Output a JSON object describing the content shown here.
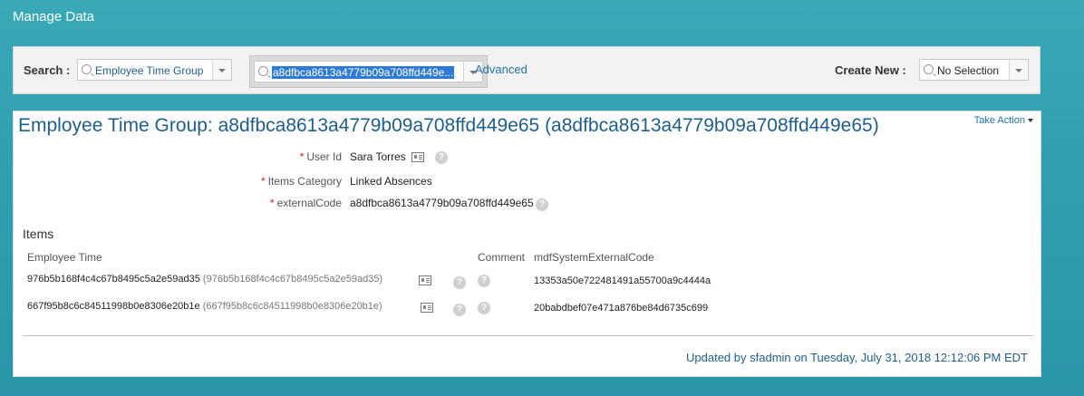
{
  "header": {
    "title": "Manage Data"
  },
  "search": {
    "label": "Search :",
    "object_type": "Employee Time Group",
    "query_value": "a8dfbca8613a4779b09a708ffd449e...",
    "advanced_link": "Advanced"
  },
  "create_new": {
    "label": "Create New :",
    "value": "No Selection"
  },
  "record": {
    "title": "Employee Time Group: a8dfbca8613a4779b09a708ffd449e65 (a8dfbca8613a4779b09a708ffd449e65)",
    "take_action": "Take Action",
    "fields": {
      "user_id": {
        "label": "User Id",
        "value": "Sara Torres"
      },
      "items_category": {
        "label": "Items Category",
        "value": "Linked Absences"
      },
      "external_code": {
        "label": "externalCode",
        "value": "a8dfbca8613a4779b09a708ffd449e65"
      }
    },
    "required_marker": "*"
  },
  "items": {
    "heading": "Items",
    "columns": {
      "employee_time": "Employee Time",
      "comment": "Comment",
      "mdf_code": "mdfSystemExternalCode"
    },
    "rows": [
      {
        "employee_time": "976b5b168f4c4c67b8495c5a2e59ad35",
        "employee_time_paren": "(976b5b168f4c4c67b8495c5a2e59ad35)",
        "mdf_code": "13353a50e722481491a55700a9c4444a"
      },
      {
        "employee_time": "667f95b8c6c84511998b0e8306e20b1e",
        "employee_time_paren": "(667f95b8c6c84511998b0e8306e20b1e)",
        "mdf_code": "20babdbef07e471a876be84d6735c699"
      }
    ]
  },
  "footer": {
    "updated_text": "Updated by sfadmin on Tuesday, July 31, 2018 12:12:06 PM EDT"
  },
  "help_glyph": "?",
  "colors": {
    "brand": "#2f9fb0",
    "link": "#1d73a8",
    "title": "#1e5f8a",
    "required": "#c02020"
  }
}
